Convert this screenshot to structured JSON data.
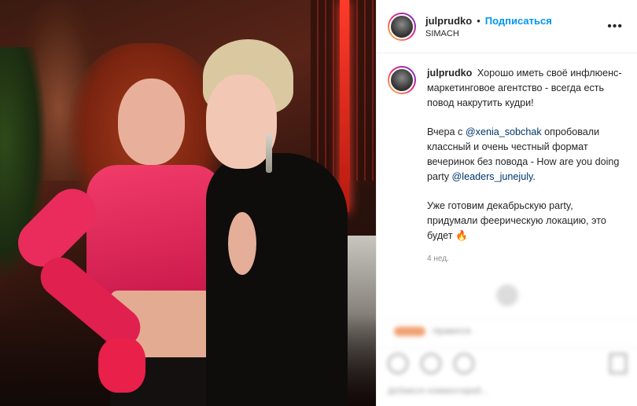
{
  "header": {
    "username": "julprudko",
    "separator": "•",
    "follow_label": "Подписаться",
    "location": "SIMACH",
    "more_icon": "more-horizontal-icon"
  },
  "caption": {
    "username": "julprudko",
    "paragraph1": "Хорошо иметь своё инфлюенс-маркетинговое агентство - всегда есть повод накрутить кудри!",
    "paragraph2_before": "Вчера с ",
    "mention1": "@xenia_sobchak",
    "paragraph2_middle": " опробовали классный и очень честный формат вечеринок без повода - How are you doing party ",
    "mention2": "@leaders_junejuly",
    "paragraph2_after": ".",
    "paragraph3": "Уже готовим декабрьскую party, придумали феерическую локацию, это будет 🔥",
    "time": "4 нед."
  },
  "blurred": {
    "likes_text": "Нравится",
    "comment_placeholder": "Добавьте комментарий..."
  },
  "colors": {
    "follow": "#0095f6",
    "mention": "#00376b",
    "story_ring": [
      "#f9ce34",
      "#ee2a7b",
      "#6228d7"
    ]
  }
}
